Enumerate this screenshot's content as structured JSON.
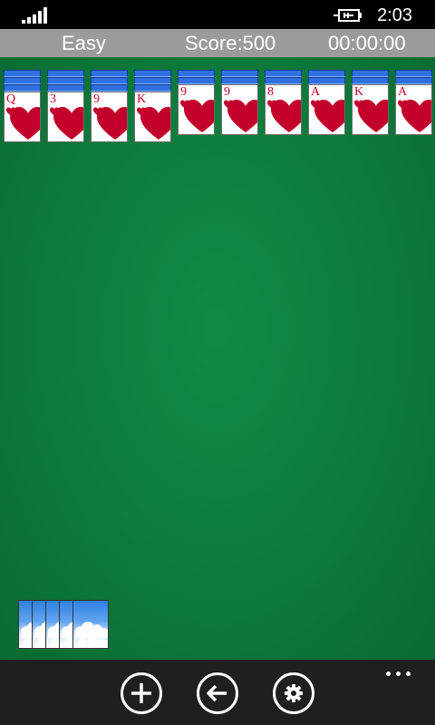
{
  "status": {
    "time": "2:03"
  },
  "header": {
    "difficulty": "Easy",
    "score": "Score:500",
    "timer": "00:00:00"
  },
  "tableau": [
    {
      "rank": "Q",
      "suit": "hearts",
      "facedown_count": 3
    },
    {
      "rank": "3",
      "suit": "hearts",
      "facedown_count": 3
    },
    {
      "rank": "9",
      "suit": "hearts",
      "facedown_count": 3
    },
    {
      "rank": "K",
      "suit": "hearts",
      "facedown_count": 3
    },
    {
      "rank": "9",
      "suit": "hearts",
      "facedown_count": 2
    },
    {
      "rank": "9",
      "suit": "hearts",
      "facedown_count": 2
    },
    {
      "rank": "8",
      "suit": "hearts",
      "facedown_count": 2
    },
    {
      "rank": "A",
      "suit": "hearts",
      "facedown_count": 2
    },
    {
      "rank": "K",
      "suit": "hearts",
      "facedown_count": 2
    },
    {
      "rank": "A",
      "suit": "hearts",
      "facedown_count": 2
    }
  ],
  "stock": {
    "piles": 5
  },
  "app_bar": {
    "buttons": [
      {
        "name": "new-game-button",
        "icon": "plus-icon"
      },
      {
        "name": "undo-button",
        "icon": "back-arrow-icon"
      },
      {
        "name": "settings-button",
        "icon": "gear-icon"
      }
    ],
    "more_icon": "ellipsis-icon"
  },
  "colors": {
    "felt": "#0d7a3b",
    "header": "#9b9b9b",
    "card_back": "#2f6fe0",
    "heart": "#c3002b",
    "app_bar": "#1f1f1f"
  }
}
